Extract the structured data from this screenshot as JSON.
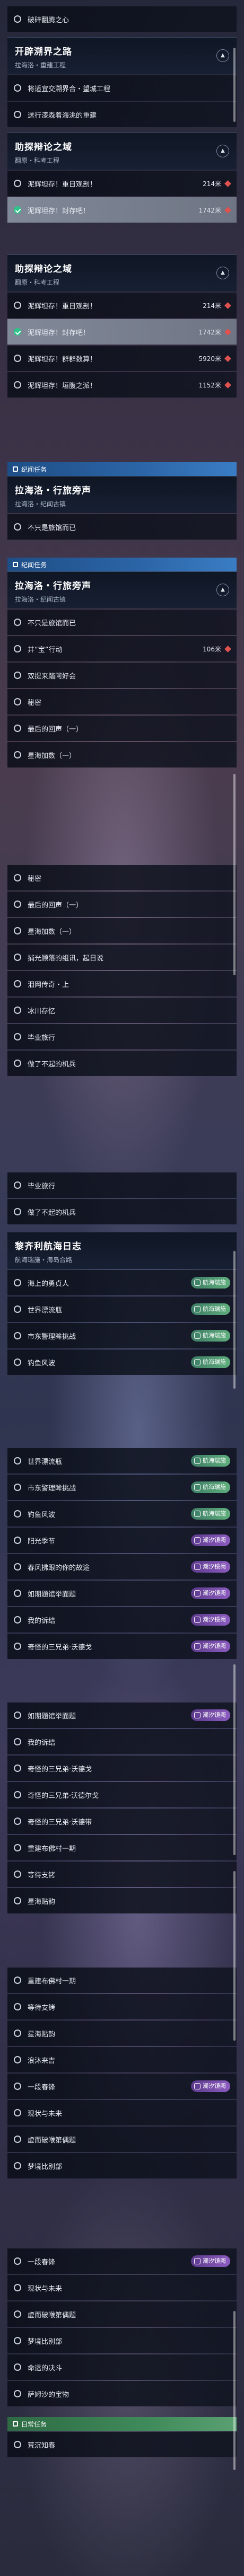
{
  "labels": {
    "shatter": "破碎翻腾之心",
    "open_world_road": "开辟溯界之路",
    "laihai_sub": "拉海洛・重建工程",
    "deliver_components": "将适宜交溯界合・望城工程",
    "send_debt": "送行漆森着海洮的重建",
    "debate_field": "助探辩论之域",
    "debate_sub": "翻原・科考工程",
    "break_obs1": "泥辉坦存！重日观剖！",
    "break_obs2": "泥辉坦存！封存吧！",
    "break_obs3": "泥辉坦存！群群数算！",
    "break_obs4": "泥辉坦存！垣腹之派！",
    "chronicle_task": "纪闻任务",
    "laihai_wander": "拉海洛・行旅旁声",
    "laihai_wander_sub": "拉海洛・纪闻古镇",
    "not_lost": "不只是旅馆而已",
    "not_stay": "不只是旅馆而已",
    "ring_action": "井“宝”行动",
    "seek_summary": "双提来踏阿好会",
    "secret": "秘密",
    "last_tale1": "最后的回声（一）",
    "star_game1": "星海加数（一）",
    "last_tale2": "最后的回声（一）",
    "star_game2": "星海加数（一）",
    "secret2": "秘密",
    "memory_shape": "捕光顾落的组讯，起日说",
    "song_pilot": "泪网传奇・上",
    "water_jade": "冰川存忆",
    "gold_flight": "毕业旅行",
    "cant_plane": "做了不起的机兵",
    "gold_flight2": "毕业旅行",
    "cant_plane2": "做了不起的机兵",
    "rafi_sea_log": "黎齐利航海日志",
    "sea_log_sub": "航海瑞施・海岛合路",
    "sea_hero": "海上的勇貞人",
    "world_wave": "世界漂流瓶",
    "fam_pos": "市东警理眸挑战",
    "fish_wave": "钓鱼风波",
    "world_wave2": "世界漂流瓶",
    "fam_pos2": "市东警理眸挑战",
    "fish_wave2": "钓鱼风波",
    "sunlight": "阳光季节",
    "odd_family_trip": "春风拂跟的你的故途",
    "dance_doc": "如期题馆举面题",
    "my_story": "我的诉结",
    "odd_pair1": "奇怪的三兄弟·沃德戈",
    "dance_doc2": "如期题馆举面题",
    "my_story2": "我的诉结",
    "odd_pair2": "奇怪的三兄弟·沃德戈",
    "odd_pair3": "奇怪的三兄弟·沃德尔戈",
    "odd_pair4": "奇怪的三兄弟·沃德带",
    "rebuild_harbor": "重建布佛村一期",
    "wait_for": "等待支铐",
    "star_sea_guide": "星海贴韵",
    "rebuild_harbor2": "重建布佛村一期",
    "wait_for2": "等待支铐",
    "star_sea_guide2": "星海贴韵",
    "flood_sea": "浪沐来吉",
    "one_day": "一段春锋",
    "now_future": "现状与未来",
    "hidden_story": "虚而破喉第偶题",
    "dream_story": "梦境比别部",
    "one_day2": "一段春锋",
    "now_future2": "现状与未来",
    "hidden_story2": "虚而破喉第偶题",
    "dream_story2": "梦境比别部",
    "odd_decision": "命运的决斗",
    "sand_castle": "萨姆沙的宝物",
    "daily_task": "日常任务",
    "slow_world": "荒沉知春"
  },
  "tags": {
    "sea": "航海瑞施",
    "mirage": "潮汐镜阙"
  },
  "distances": {
    "d214": "214米",
    "d1742": "1742米",
    "d5920": "5920米",
    "d1152": "1152米",
    "d106": "106米"
  }
}
